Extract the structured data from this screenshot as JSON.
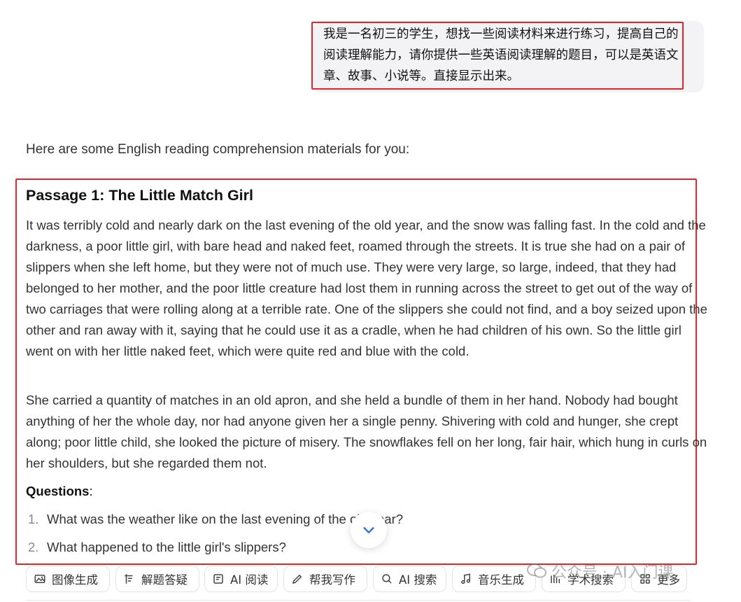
{
  "user_message": {
    "text": "我是一名初三的学生，想找一些阅读材料来进行练习，提高自己的阅读理解能力，请你提供一些英语阅读理解的题目，可以是英语文章、故事、小说等。直接显示出来。"
  },
  "response": {
    "intro": "Here are some English reading comprehension materials for you:",
    "passage_title": "Passage 1: The Little Match Girl",
    "paragraphs": [
      "It was terribly cold and nearly dark on the last evening of the old year, and the snow was falling fast. In the cold and the darkness, a poor little girl, with bare head and naked feet, roamed through the streets. It is true she had on a pair of slippers when she left home, but they were not of much use. They were very large, so large, indeed, that they had belonged to her mother, and the poor little creature had lost them in running across the street to get out of the way of two carriages that were rolling along at a terrible rate. One of the slippers she could not find, and a boy seized upon the other and ran away with it, saying that he could use it as a cradle, when he had children of his own. So the little girl went on with her little naked feet, which were quite red and blue with the cold.",
      "She carried a quantity of matches in an old apron, and she held a bundle of them in her hand. Nobody had bought anything of her the whole day, nor had anyone given her a single penny. Shivering with cold and hunger, she crept along; poor little child, she looked the picture of misery. The snowflakes fell on her long, fair hair, which hung in curls on her shoulders, but she regarded them not."
    ],
    "questions_heading": "Questions",
    "questions_colon": ":",
    "questions": [
      {
        "num": "1.",
        "text": "What was the weather like on the last evening of the old year?"
      },
      {
        "num": "2.",
        "text": "What happened to the little girl's slippers?"
      }
    ]
  },
  "toolbar": {
    "items": [
      {
        "label": "图像生成",
        "icon": "image-gen-icon"
      },
      {
        "label": "解题答疑",
        "icon": "solve-icon"
      },
      {
        "label": "AI 阅读",
        "icon": "ai-read-icon"
      },
      {
        "label": "帮我写作",
        "icon": "write-icon"
      },
      {
        "label": "AI 搜索",
        "icon": "ai-search-icon"
      },
      {
        "label": "音乐生成",
        "icon": "music-icon"
      },
      {
        "label": "学术搜索",
        "icon": "academic-search-icon"
      },
      {
        "label": "更多",
        "icon": "more-grid-icon"
      }
    ]
  },
  "watermark": {
    "text": "公众号 · AI入门课"
  },
  "colors": {
    "highlight_border": "#e8242b",
    "bubble_bg": "#f3f3f5",
    "scroll_arrow": "#2f6fe4"
  }
}
